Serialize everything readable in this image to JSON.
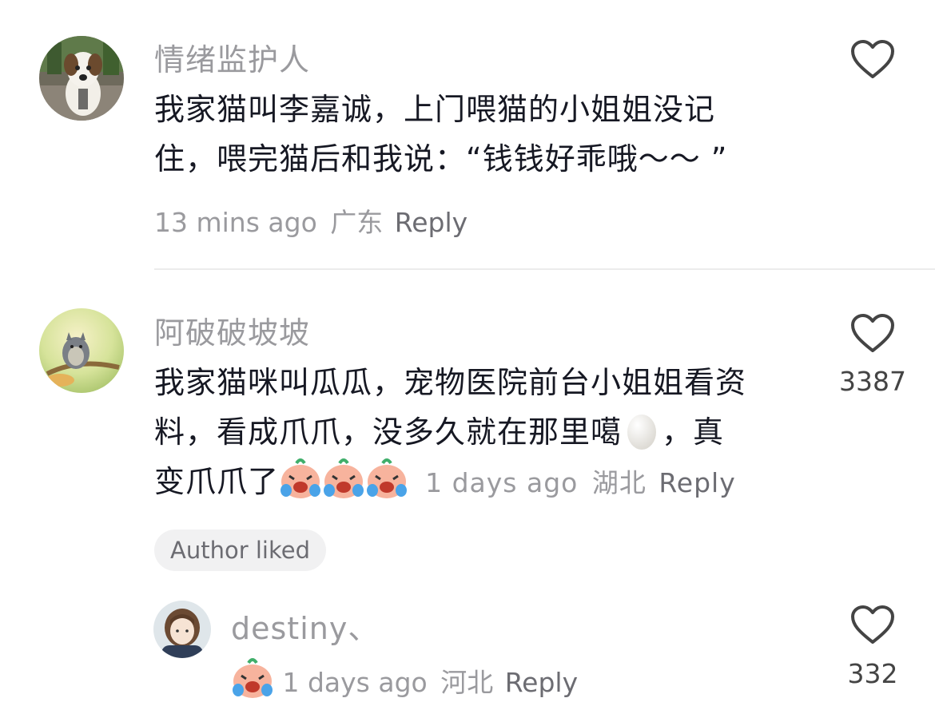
{
  "comments": [
    {
      "username": "情绪监护人",
      "text_lines": [
        "我家猫叫李嘉诚，上门喂猫的小姐姐没记",
        "住，喂完猫后和我说：“钱钱好乖哦～～ ”"
      ],
      "time": "13 mins ago",
      "location": "广东",
      "reply_label": "Reply",
      "like_count": ""
    },
    {
      "username": "阿破破坡坡",
      "text_lines": [
        "我家猫咪叫瓜瓜，宠物医院前台小姐姐看资",
        "料，看成爪爪，没多久就在那里噶",
        "，真",
        "变爪爪了"
      ],
      "time": "1 days ago",
      "location": "湖北",
      "reply_label": "Reply",
      "like_count": "3387",
      "badge": "Author liked",
      "emoji_inline": "egg-emoji",
      "emoji_trailing": "crying-face-emoji"
    }
  ],
  "reply": {
    "username": "destiny、",
    "time": "1 days ago",
    "location": "河北",
    "reply_label": "Reply",
    "like_count": "332",
    "emoji": "crying-face-emoji"
  },
  "icons": {
    "like": "heart-outline-icon"
  },
  "colors": {
    "username": "#9a9a9e",
    "text": "#161823",
    "meta": "#9a9a9e",
    "badge_bg": "#f1f1f2"
  }
}
